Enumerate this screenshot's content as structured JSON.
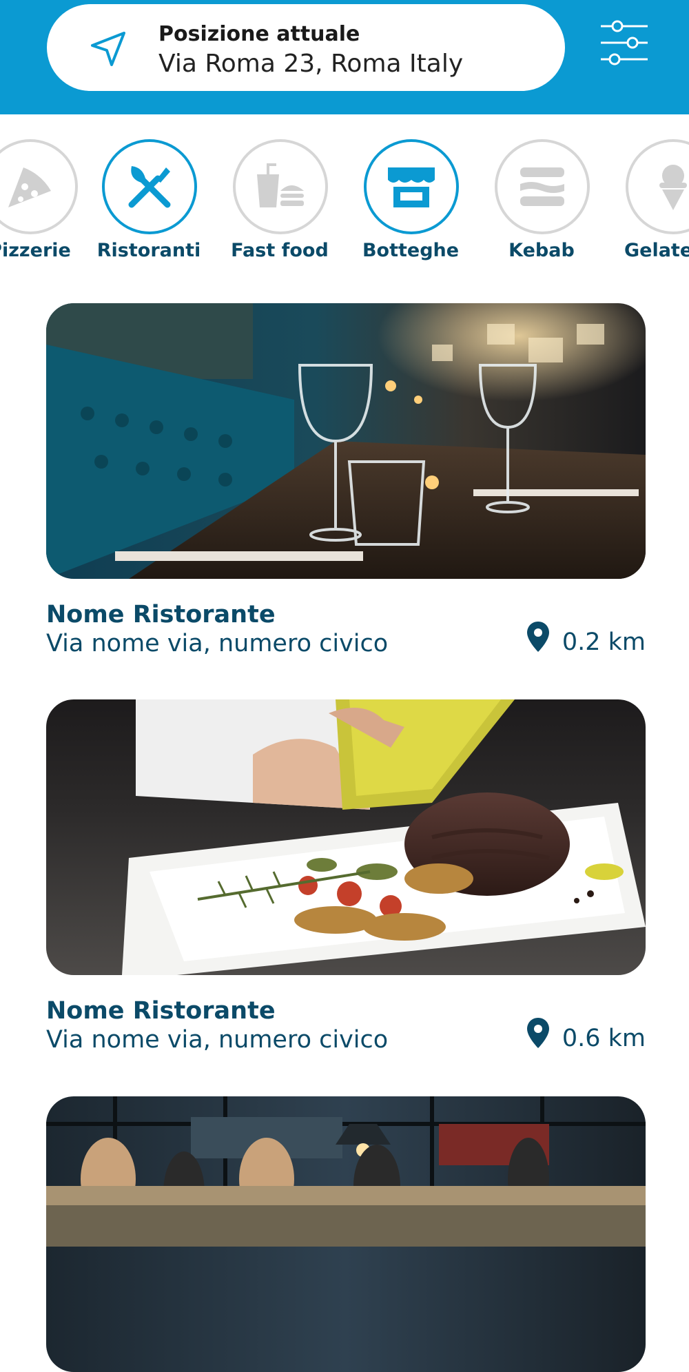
{
  "header": {
    "location_label": "Posizione attuale",
    "location_address": "Via Roma 23, Roma Italy",
    "location_icon": "navigation-arrow-icon",
    "filter_icon": "sliders-icon"
  },
  "categories": [
    {
      "label": "Pizzerie",
      "icon": "pizza-icon",
      "active": false
    },
    {
      "label": "Ristoranti",
      "icon": "fork-knife-icon",
      "active": true
    },
    {
      "label": "Fast food",
      "icon": "fast-food-icon",
      "active": false
    },
    {
      "label": "Botteghe",
      "icon": "shop-icon",
      "active": true
    },
    {
      "label": "Kebab",
      "icon": "kebab-icon",
      "active": false
    },
    {
      "label": "Gelaterie",
      "icon": "ice-cream-icon",
      "active": false
    }
  ],
  "restaurants": [
    {
      "name": "Nome Ristorante",
      "address": "Via nome via, numero civico",
      "distance": "0.2 km"
    },
    {
      "name": "Nome Ristorante",
      "address": "Via nome via, numero civico",
      "distance": "0.6 km"
    }
  ],
  "colors": {
    "primary": "#0b9ad2",
    "text_dark": "#0b4a68",
    "inactive": "#d6d6d6"
  }
}
